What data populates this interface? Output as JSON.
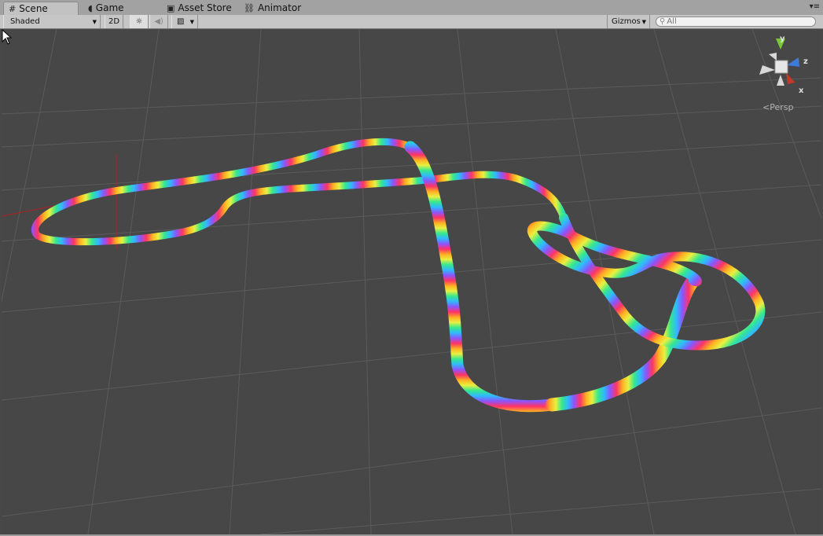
{
  "tabs": [
    {
      "label": "Scene",
      "icon": "grid-icon",
      "active": true
    },
    {
      "label": "Game",
      "icon": "pacman-icon",
      "active": false
    },
    {
      "label": "Asset Store",
      "icon": "bag-icon",
      "active": false
    },
    {
      "label": "Animator",
      "icon": "animator-icon",
      "active": false
    }
  ],
  "toolbar": {
    "draw_mode": "Shaded",
    "mode_2d": "2D",
    "gizmos": "Gizmos",
    "search_placeholder": "All"
  },
  "gizmo": {
    "axis_y": "y",
    "axis_z": "z",
    "axis_x": "x",
    "projection": "Persp"
  },
  "colors": {
    "viewport_bg": "#474747",
    "grid_line": "#5a5a5a",
    "axis_x": "#c0392b",
    "axis_y": "#7cc63a",
    "axis_z": "#3d7bd9"
  }
}
